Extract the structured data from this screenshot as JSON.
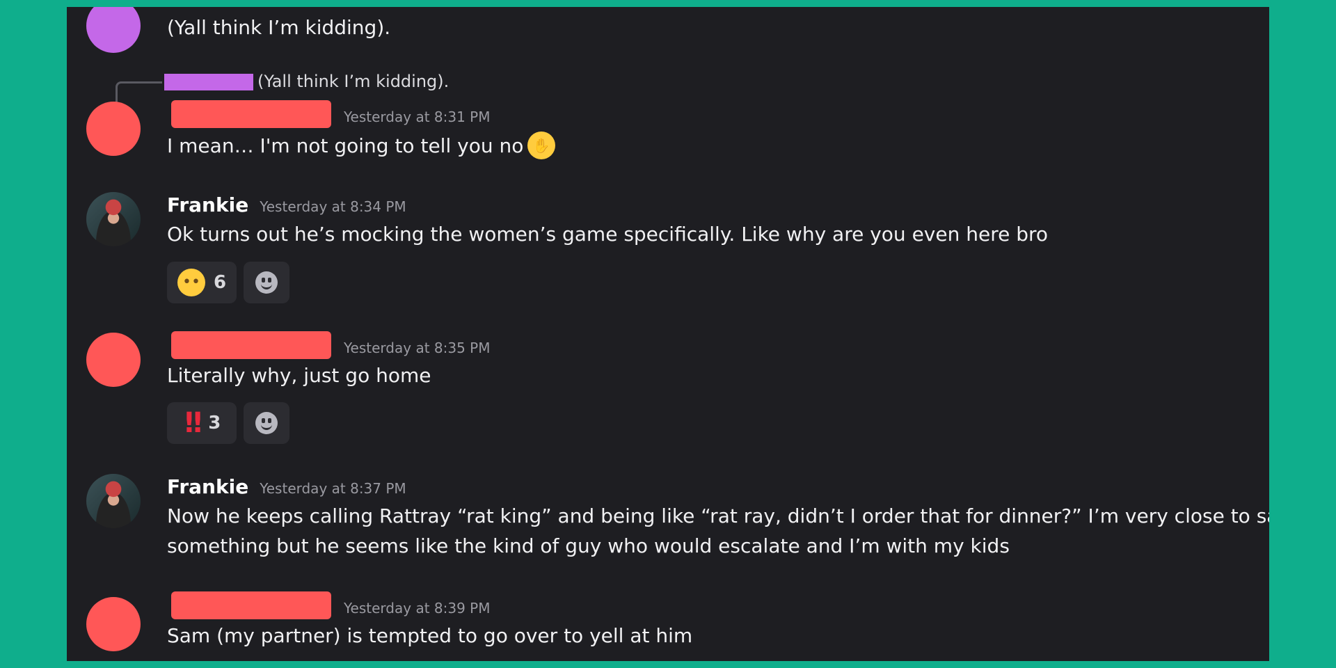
{
  "messages": [
    {
      "text": "(Yall think I’m kidding)."
    },
    {
      "reply_preview": "(Yall think I’m kidding).",
      "timestamp": "Yesterday at 8:31 PM",
      "text": "I mean… I'm not going to tell you no",
      "emoji": "hand-over-mouth"
    },
    {
      "username": "Frankie",
      "timestamp": "Yesterday at 8:34 PM",
      "text": "Ok turns out he’s mocking the women’s game specifically. Like why are you even here bro",
      "reaction": {
        "emoji": "eye-roll",
        "count": "6"
      }
    },
    {
      "timestamp": "Yesterday at 8:35 PM",
      "text": "Literally why, just go home",
      "reaction": {
        "emoji": "double-exclamation",
        "count": "3"
      }
    },
    {
      "username": "Frankie",
      "timestamp": "Yesterday at 8:37 PM",
      "text_line1": "Now he keeps calling Rattray “rat king” and being like “rat ray, didn’t I order that for dinner?” I’m very close to saying",
      "text_line2": "something but he seems like the kind of guy who would escalate and I’m with my kids"
    },
    {
      "timestamp": "Yesterday at 8:39 PM",
      "text": "Sam (my partner) is tempted to go over to yell at him"
    }
  ],
  "colors": {
    "frame": "#0fae8c",
    "panel": "#1e1e22",
    "redact_red": "#ff5757",
    "redact_purple": "#c468e8",
    "text": "#f1f1f3",
    "timestamp": "#9a9aa1"
  }
}
